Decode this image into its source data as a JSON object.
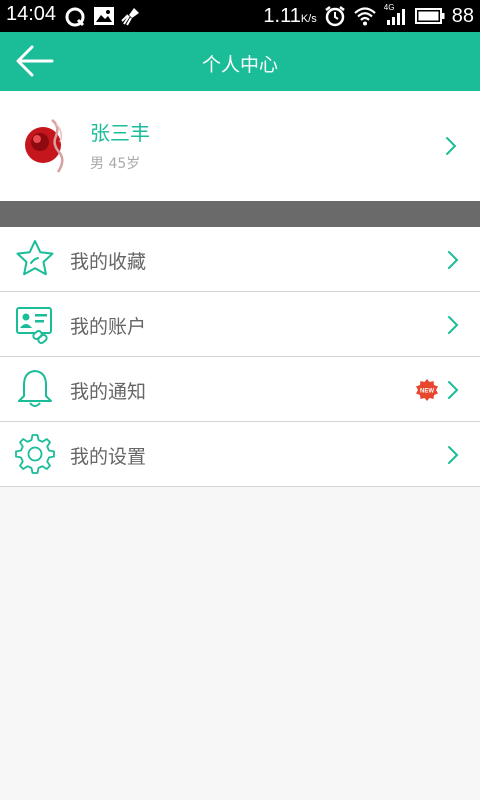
{
  "status_bar": {
    "time": "14:04",
    "net_speed": "1.11",
    "net_speed_unit": "K/s",
    "network_type": "4G",
    "battery": "88",
    "left_icons": [
      "q-app-icon",
      "gallery-icon",
      "cleaner-icon"
    ],
    "right_icons": [
      "alarm-icon",
      "wifi-icon",
      "signal-icon",
      "battery-icon"
    ]
  },
  "header": {
    "title": "个人中心",
    "back_icon": "back-arrow-icon"
  },
  "profile": {
    "name": "张三丰",
    "gender": "男",
    "age": "45岁"
  },
  "menu": [
    {
      "label": "我的收藏",
      "icon": "star-icon"
    },
    {
      "label": "我的账户",
      "icon": "account-card-icon"
    },
    {
      "label": "我的通知",
      "icon": "bell-icon",
      "badge": "NEW"
    },
    {
      "label": "我的设置",
      "icon": "gear-icon"
    }
  ],
  "colors": {
    "brand": "#1bbc98",
    "badge": "#e8472e",
    "band": "#6a6a6a"
  }
}
